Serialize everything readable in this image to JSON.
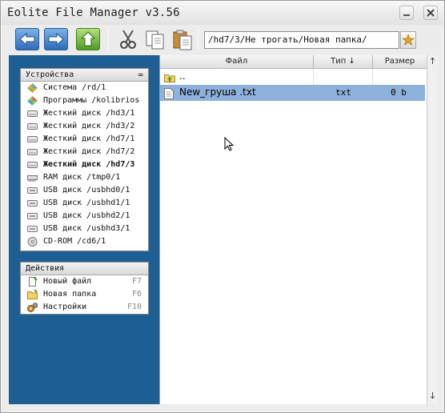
{
  "app": {
    "title": "Eolite File Manager v3.56"
  },
  "toolbar": {
    "path": "/hd7/3/Не трогать/Новая папка/",
    "buttons": [
      "back-icon",
      "forward-icon",
      "up-icon",
      "cut-icon",
      "copy-icon",
      "paste-icon"
    ]
  },
  "devices": {
    "title": "Устройства",
    "toggle": "=",
    "items": [
      {
        "label": "Система /rd/1",
        "icon": "system-icon"
      },
      {
        "label": "Программы /kolibrios",
        "icon": "programs-icon"
      },
      {
        "label": "Жесткий диск /hd3/1",
        "icon": "hdd-icon"
      },
      {
        "label": "Жесткий диск /hd3/2",
        "icon": "hdd-icon"
      },
      {
        "label": "Жесткий диск /hd7/1",
        "icon": "hdd-icon"
      },
      {
        "label": "Жесткий диск /hd7/2",
        "icon": "hdd-icon"
      },
      {
        "label": "Жесткий диск /hd7/3",
        "icon": "hdd-icon",
        "active": true
      },
      {
        "label": "RAM диск /tmp0/1",
        "icon": "ram-icon"
      },
      {
        "label": "USB диск /usbhd0/1",
        "icon": "usb-icon"
      },
      {
        "label": "USB диск /usbhd1/1",
        "icon": "usb-icon"
      },
      {
        "label": "USB диск /usbhd2/1",
        "icon": "usb-icon"
      },
      {
        "label": "USB диск /usbhd3/1",
        "icon": "usb-icon"
      },
      {
        "label": "CD-ROM /cd6/1",
        "icon": "cdrom-icon"
      }
    ]
  },
  "actions": {
    "title": "Действия",
    "items": [
      {
        "label": "Новый файл",
        "hotkey": "F7",
        "icon": "new-file-icon"
      },
      {
        "label": "Новая папка",
        "hotkey": "F6",
        "icon": "new-folder-icon"
      },
      {
        "label": "Настройки",
        "hotkey": "F10",
        "icon": "settings-icon"
      }
    ]
  },
  "filelist": {
    "columns": {
      "name": "Файл",
      "type": "Тип ↓",
      "size": "Размер"
    },
    "scroll_up": "↑",
    "scroll_down": "↓",
    "rows": [
      {
        "name": "..",
        "type": "",
        "size": "",
        "icon": "parent-folder-icon"
      },
      {
        "name": "New_груша .txt",
        "type": "txt",
        "size": "0 b",
        "icon": "text-file-icon",
        "selected": true
      }
    ]
  },
  "colors": {
    "panel_bg": "#1d5f95",
    "selection": "#8fb2dc"
  }
}
